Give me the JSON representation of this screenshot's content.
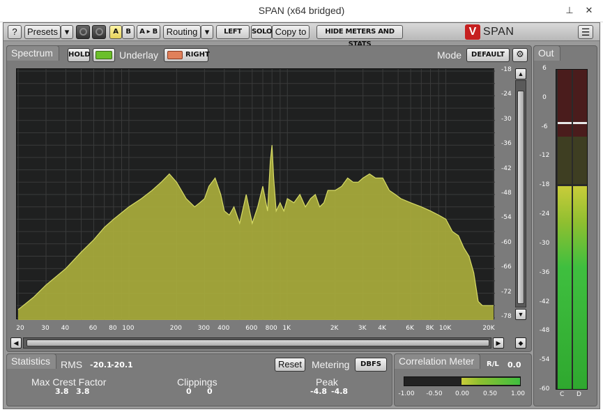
{
  "window": {
    "title": "SPAN (x64 bridged)",
    "pin_icon": "pin-icon",
    "close_icon": "close-icon"
  },
  "toolbar": {
    "help_label": "?",
    "presets_label": "Presets",
    "dropdown_glyph": "▾",
    "a_label": "A",
    "b_label": "B",
    "ab_label": "A ▸ B",
    "routing_label": "Routing",
    "left_label": "LEFT",
    "solo_label": "SOLO",
    "copyto_label": "Copy to",
    "hide_meters_label": "HIDE METERS AND STATS",
    "logo_text": "SPAN",
    "logo_mark": "V",
    "menu_glyph": "☰"
  },
  "spectrum": {
    "tab_label": "Spectrum",
    "hold_label": "HOLD",
    "underlay_label": "Underlay",
    "right_label": "RIGHT",
    "mode_label": "Mode",
    "mode_value": "DEFAULT",
    "gear_glyph": "⚙",
    "db_ticks": [
      "-18",
      "-24",
      "-30",
      "-36",
      "-42",
      "-48",
      "-54",
      "-60",
      "-66",
      "-72",
      "-78"
    ],
    "hz_ticks": [
      "20",
      "30",
      "40",
      "60",
      "80",
      "100",
      "200",
      "300",
      "400",
      "600",
      "800",
      "1K",
      "2K",
      "3K",
      "4K",
      "6K",
      "8K",
      "10K",
      "20K"
    ],
    "colors": {
      "fill": "#a9ad3c",
      "line": "#d8dc66",
      "grid": "#3a3b3b",
      "background": "#1f2020"
    }
  },
  "scrollbar": {
    "left_glyph": "◀",
    "right_glyph": "▶",
    "up_glyph": "▲",
    "down_glyph": "▼",
    "diamond_glyph": "◆"
  },
  "out_meter": {
    "tab_label": "Out",
    "ticks": [
      "6",
      "0",
      "-6",
      "-12",
      "-18",
      "-24",
      "-30",
      "-36",
      "-42",
      "-48",
      "-54",
      "-60"
    ],
    "channel_left": "C",
    "channel_right": "D",
    "level_db": -18,
    "peak_hold_db": -4.8,
    "colors": {
      "green": "#3fbf3f",
      "yellow": "#c9cc3a",
      "red": "#7a2020"
    }
  },
  "statistics": {
    "tab_label": "Statistics",
    "rms_label": "RMS",
    "rms_left": "-20.1",
    "rms_right": "-20.1",
    "reset_label": "Reset",
    "metering_label": "Metering",
    "metering_value": "DBFS",
    "crest_label": "Max Crest Factor",
    "crest_left": "3.8",
    "crest_right": "3.8",
    "clip_label": "Clippings",
    "clip_left": "0",
    "clip_right": "0",
    "peak_label": "Peak",
    "peak_left": "-4.8",
    "peak_right": "-4.8"
  },
  "correlation": {
    "tab_label": "Correlation Meter",
    "rl_label": "R/L",
    "rl_value": "0.0",
    "ticks": [
      "-1.00",
      "-0.50",
      "0.00",
      "0.50",
      "1.00"
    ],
    "value": 0.0
  },
  "chart_data": {
    "type": "area",
    "x_scale": "log",
    "xlim": [
      20,
      20000
    ],
    "ylim": [
      -78,
      -18
    ],
    "x": [
      20,
      25,
      30,
      40,
      50,
      60,
      70,
      80,
      100,
      120,
      140,
      160,
      180,
      200,
      230,
      260,
      280,
      300,
      320,
      350,
      380,
      400,
      430,
      460,
      500,
      550,
      600,
      650,
      700,
      750,
      780,
      800,
      820,
      850,
      900,
      950,
      1000,
      1100,
      1200,
      1300,
      1400,
      1500,
      1600,
      1700,
      1800,
      2000,
      2200,
      2400,
      2600,
      2800,
      3000,
      3300,
      3600,
      4000,
      4400,
      4800,
      5200,
      6000,
      7000,
      8000,
      9000,
      10000,
      11000,
      12000,
      13000,
      14000,
      15000,
      16000,
      17000,
      18000,
      20000
    ],
    "y": [
      -76,
      -73,
      -70,
      -66,
      -62,
      -59,
      -56,
      -54,
      -51,
      -49,
      -47,
      -45,
      -43,
      -45,
      -49,
      -51,
      -50,
      -49,
      -46,
      -44,
      -48,
      -52,
      -53,
      -51,
      -55,
      -48,
      -55,
      -51,
      -46,
      -52,
      -40,
      -36,
      -44,
      -52,
      -50,
      -52,
      -49,
      -50,
      -48,
      -51,
      -49,
      -48,
      -51,
      -50,
      -47,
      -47,
      -46,
      -44,
      -45,
      -45,
      -44,
      -43,
      -44,
      -44,
      -47,
      -48,
      -49,
      -50,
      -51,
      -52,
      -53,
      -54,
      -57,
      -58,
      -61,
      -63,
      -67,
      -74,
      -75,
      -75,
      -75
    ]
  }
}
